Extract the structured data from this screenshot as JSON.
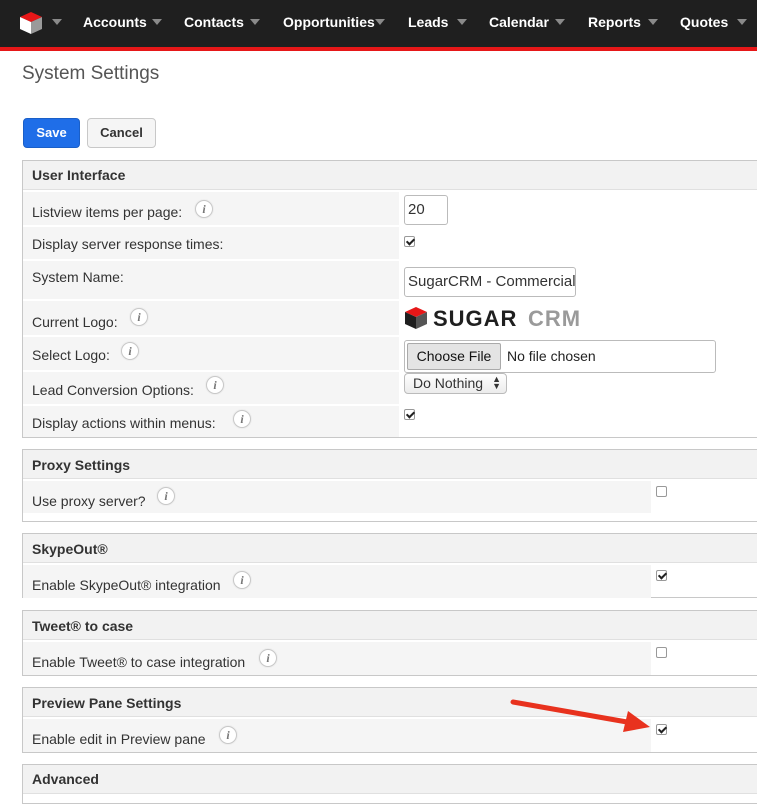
{
  "nav": {
    "items": [
      {
        "label": "Accounts"
      },
      {
        "label": "Contacts"
      },
      {
        "label": "Opportunities"
      },
      {
        "label": "Leads"
      },
      {
        "label": "Calendar"
      },
      {
        "label": "Reports"
      },
      {
        "label": "Quotes"
      }
    ]
  },
  "page": {
    "title": "System Settings"
  },
  "actions": {
    "save": "Save",
    "cancel": "Cancel"
  },
  "user_interface": {
    "title": "User Interface",
    "listview_label": "Listview items per page:",
    "listview_value": "20",
    "response_times_label": "Display server response times:",
    "response_times_checked": true,
    "system_name_label": "System Name:",
    "system_name_value": "SugarCRM - Commercial",
    "current_logo_label": "Current Logo:",
    "logo_text_a": "SUGAR",
    "logo_text_b": "CRM",
    "select_logo_label": "Select Logo:",
    "choose_file": "Choose File",
    "no_file": "No file chosen",
    "lead_conversion_label": "Lead Conversion Options:",
    "lead_conversion_value": "Do Nothing",
    "actions_menus_label": "Display actions within menus:",
    "actions_menus_checked": true
  },
  "proxy": {
    "title": "Proxy Settings",
    "label": "Use proxy server?",
    "checked": false
  },
  "skype": {
    "title": "SkypeOut®",
    "label": "Enable SkypeOut® integration",
    "checked": true
  },
  "tweet": {
    "title": "Tweet® to case",
    "label": "Enable Tweet® to case integration",
    "checked": false
  },
  "preview": {
    "title": "Preview Pane Settings",
    "label": "Enable edit in Preview pane",
    "checked": true
  },
  "advanced": {
    "title": "Advanced"
  },
  "colors": {
    "accent": "#e61718",
    "save_button": "#1f6ee8",
    "annotation_arrow": "#e8321e"
  },
  "icons": [
    "sugarcube-logo-icon",
    "chevron-down-icon",
    "info-icon",
    "checkbox-icon",
    "arrow-annotation-icon"
  ]
}
